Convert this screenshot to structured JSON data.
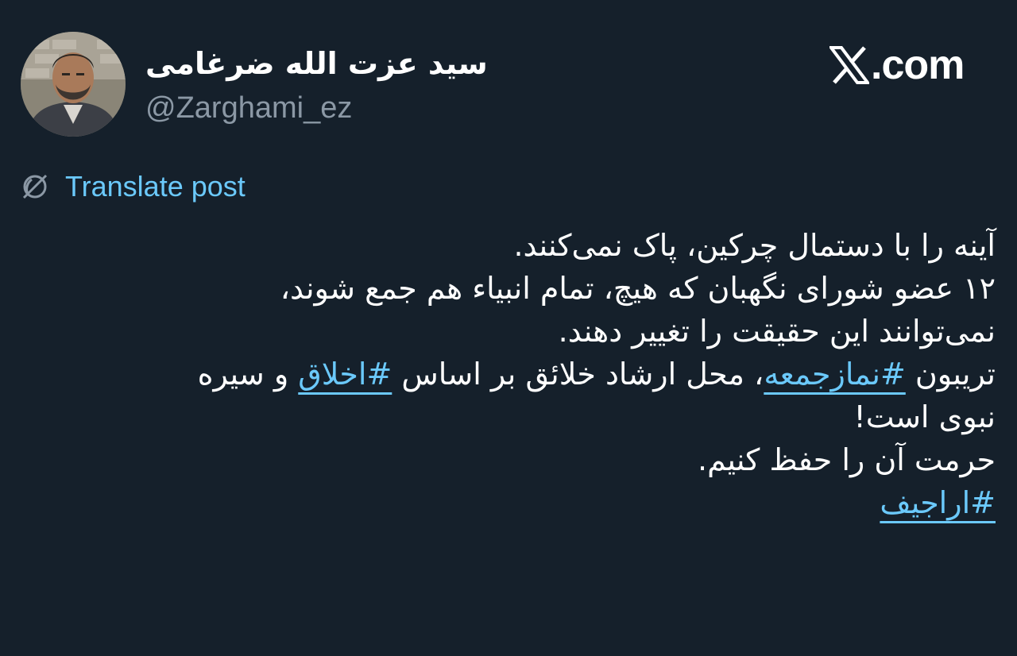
{
  "author": {
    "display_name": "سید عزت الله ضرغامی",
    "handle": "@Zarghami_ez"
  },
  "site": {
    "logo_icon": "x-logo-icon",
    "name": ".com"
  },
  "translate": {
    "icon": "globe-icon",
    "label": "Translate post"
  },
  "post": {
    "lines": [
      {
        "segments": [
          {
            "type": "text",
            "text": "آینه را با دستمال چرکین، پاک نمی‌کنند."
          }
        ]
      },
      {
        "segments": [
          {
            "type": "text",
            "text": "۱۲ عضو شورای نگهبان که هیچ، تمام انبیاء هم جمع شوند،"
          }
        ]
      },
      {
        "segments": [
          {
            "type": "text",
            "text": "نمی‌توانند این حقیقت را تغییر دهند."
          }
        ]
      },
      {
        "segments": [
          {
            "type": "text",
            "text": "تریبون "
          },
          {
            "type": "hashtag",
            "text": "#نمازجمعه"
          },
          {
            "type": "text",
            "text": "، محل ارشاد خلائق بر اساس "
          },
          {
            "type": "hashtag",
            "text": "#اخلاق"
          },
          {
            "type": "text",
            "text": " و سیره"
          }
        ]
      },
      {
        "segments": [
          {
            "type": "text",
            "text": "نبوی است!"
          }
        ]
      },
      {
        "segments": [
          {
            "type": "text",
            "text": "حرمت آن را حفظ کنیم."
          }
        ]
      },
      {
        "segments": [
          {
            "type": "hashtag",
            "text": "#اراجیف"
          }
        ]
      }
    ]
  },
  "colors": {
    "background": "#15202b",
    "link": "#6bc9fb",
    "secondary_text": "#8b98a5",
    "primary_text": "#ffffff"
  }
}
